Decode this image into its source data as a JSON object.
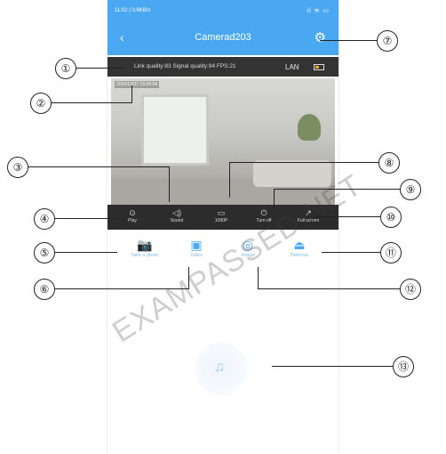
{
  "status_bar": {
    "left": "11:02 | 0.6KB/s",
    "right": "il ≋ ▭"
  },
  "app_bar": {
    "back_icon": "chevron-left-icon",
    "title": "Camerad203",
    "settings_icon": "gear-icon"
  },
  "info_bar": {
    "stats": "Link quality:83  Signal quality:94  FPS:21",
    "network": "LAN"
  },
  "video": {
    "timestamp": "2020/12/07 16:29:04"
  },
  "controls": [
    {
      "label": "Play",
      "icon": "play-icon"
    },
    {
      "label": "Sound",
      "icon": "speaker-icon"
    },
    {
      "label": "1080P",
      "icon": "resolution-icon"
    },
    {
      "label": "Turn off",
      "icon": "power-icon"
    },
    {
      "label": "Full screen",
      "icon": "fullscreen-icon"
    }
  ],
  "actions": [
    {
      "label": "Take a photo",
      "icon": "camera-icon"
    },
    {
      "label": "Video",
      "icon": "video-record-icon"
    },
    {
      "label": "Image",
      "icon": "gallery-icon"
    },
    {
      "label": "Defense",
      "icon": "alarm-icon"
    }
  ],
  "callouts": [
    "①",
    "②",
    "③",
    "④",
    "⑤",
    "⑥",
    "⑦",
    "⑧",
    "⑨",
    "⑩",
    "⑪",
    "⑫",
    "⑬"
  ],
  "watermark": "EXAMPASSED.NET"
}
